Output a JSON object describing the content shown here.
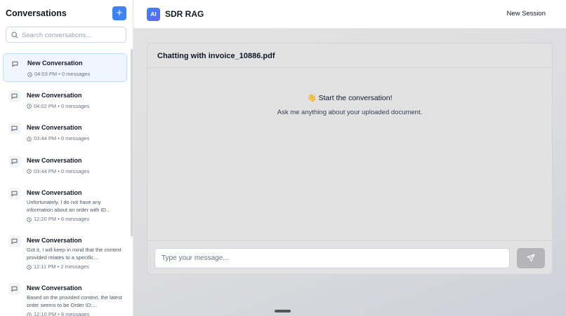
{
  "sidebar": {
    "title": "Conversations",
    "add_label": "+",
    "search_placeholder": "Search conversations...",
    "conversations": [
      {
        "title": "New Conversation",
        "preview": "",
        "time": "04:03 PM",
        "count": "• 0 messages",
        "active": true
      },
      {
        "title": "New Conversation",
        "preview": "",
        "time": "04:02 PM",
        "count": "• 0 messages"
      },
      {
        "title": "New Conversation",
        "preview": "",
        "time": "03:44 PM",
        "count": "• 0 messages"
      },
      {
        "title": "New Conversation",
        "preview": "",
        "time": "03:44 PM",
        "count": "• 0 messages"
      },
      {
        "title": "New Conversation",
        "preview": "Unfortunately, I do not have any information about an order with ID...",
        "time": "12:20 PM",
        "count": "• 6 messages"
      },
      {
        "title": "New Conversation",
        "preview": "Got it, I will keep in mind that the context provided relates to a specific...",
        "time": "12:11 PM",
        "count": "• 2 messages"
      },
      {
        "title": "New Conversation",
        "preview": "Based on the provided context, the latest order seems to be Order ID:...",
        "time": "12:10 PM",
        "count": "• 9 messages"
      }
    ]
  },
  "header": {
    "logo_text": "AI",
    "app_title": "SDR RAG",
    "new_session_label": "New Session"
  },
  "chat": {
    "title": "Chatting with invoice_10886.pdf",
    "empty_heading": "👋 Start the conversation!",
    "empty_subtext": "Ask me anything about your uploaded document.",
    "input_placeholder": "Type your message..."
  },
  "colors": {
    "accent": "#3b82f6",
    "active_item_bg": "#eff6ff"
  }
}
